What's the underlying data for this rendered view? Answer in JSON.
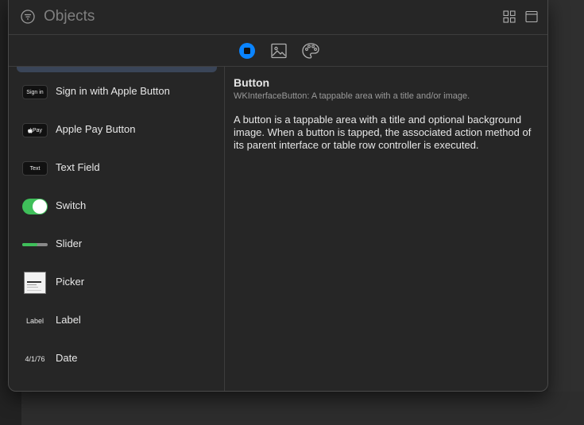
{
  "window": {
    "search_placeholder": "Objects",
    "icons": {
      "filter": "filter-icon",
      "grid_view": "grid-view-icon",
      "list_view": "list-view-icon"
    }
  },
  "tabs": [
    {
      "name": "objects",
      "icon": "objects-icon",
      "selected": true
    },
    {
      "name": "media",
      "icon": "image-icon",
      "selected": false
    },
    {
      "name": "colors",
      "icon": "palette-icon",
      "selected": false
    }
  ],
  "accent_color": "#0a84ff",
  "switch_color": "#3fbf5a",
  "list": {
    "items": [
      {
        "label": "Sign in with Apple Button",
        "thumb": " Sign in"
      },
      {
        "label": "Apple Pay Button",
        "thumb": "Pay"
      },
      {
        "label": "Text Field",
        "thumb": "Text"
      },
      {
        "label": "Switch",
        "thumb": "switch"
      },
      {
        "label": "Slider",
        "thumb": "slider",
        "value": 0.6
      },
      {
        "label": "Picker",
        "thumb": "picker"
      },
      {
        "label": "Label",
        "thumb": "Label"
      },
      {
        "label": "Date",
        "thumb": "4/1/76"
      }
    ]
  },
  "detail": {
    "title": "Button",
    "subtitle": "WKInterfaceButton: A tappable area with a title and/or image.",
    "description": "A button is a tappable area with a title and optional background image. When a button is tapped, the associated action method of its parent interface or table row controller is executed."
  }
}
